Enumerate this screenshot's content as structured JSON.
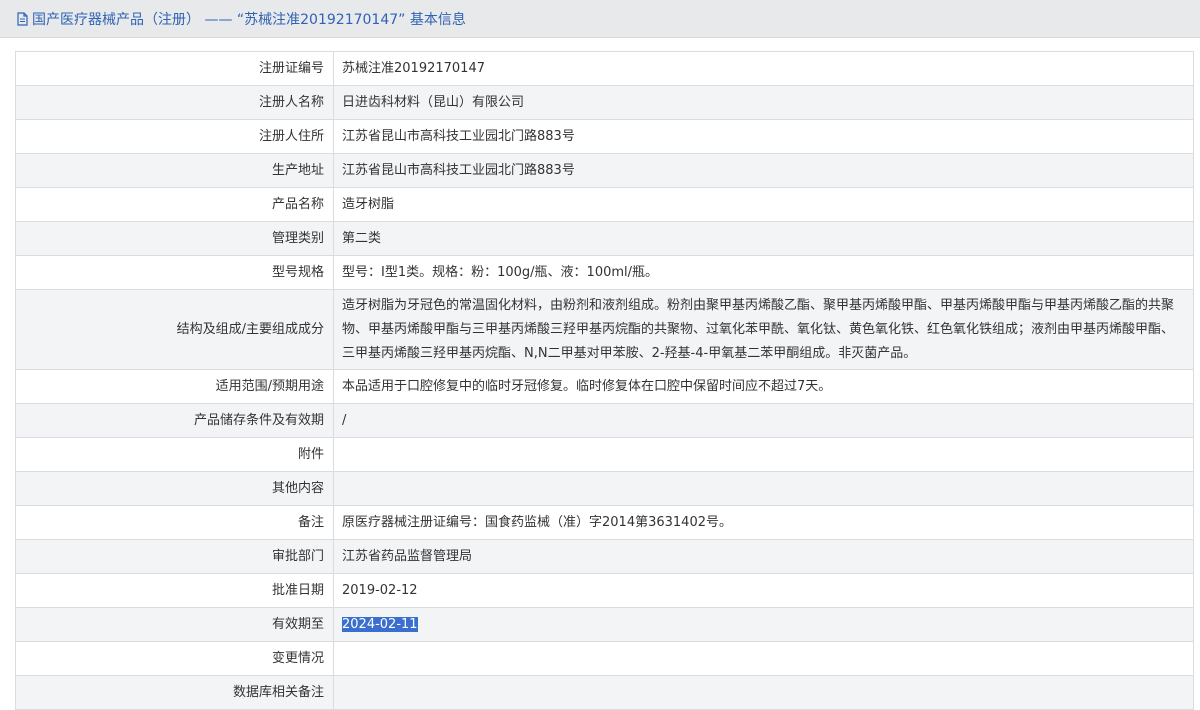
{
  "header": {
    "title": "国产医疗器械产品（注册） —— “苏械注准20192170147” 基本信息",
    "icon": "document-icon"
  },
  "rows": [
    {
      "label": "注册证编号",
      "value": "苏械注准20192170147"
    },
    {
      "label": "注册人名称",
      "value": "日进齿科材料（昆山）有限公司"
    },
    {
      "label": "注册人住所",
      "value": "江苏省昆山市高科技工业园北门路883号"
    },
    {
      "label": "生产地址",
      "value": "江苏省昆山市高科技工业园北门路883号"
    },
    {
      "label": "产品名称",
      "value": "造牙树脂"
    },
    {
      "label": "管理类别",
      "value": "第二类"
    },
    {
      "label": "型号规格",
      "value": "型号：Ⅰ型1类。规格：粉：100g/瓶、液：100ml/瓶。"
    },
    {
      "label": "结构及组成/主要组成成分",
      "value": "造牙树脂为牙冠色的常温固化材料，由粉剂和液剂组成。粉剂由聚甲基丙烯酸乙酯、聚甲基丙烯酸甲酯、甲基丙烯酸甲酯与甲基丙烯酸乙酯的共聚物、甲基丙烯酸甲酯与三甲基丙烯酸三羟甲基丙烷酯的共聚物、过氧化苯甲酰、氧化钛、黄色氧化铁、红色氧化铁组成；液剂由甲基丙烯酸甲酯、三甲基丙烯酸三羟甲基丙烷酯、N,N二甲基对甲苯胺、2-羟基-4-甲氧基二苯甲酮组成。非灭菌产品。"
    },
    {
      "label": "适用范围/预期用途",
      "value": "本品适用于口腔修复中的临时牙冠修复。临时修复体在口腔中保留时间应不超过7天。"
    },
    {
      "label": "产品储存条件及有效期",
      "value": "/"
    },
    {
      "label": "附件",
      "value": ""
    },
    {
      "label": "其他内容",
      "value": ""
    },
    {
      "label": "备注",
      "value": "原医疗器械注册证编号：国食药监械（准）字2014第3631402号。"
    },
    {
      "label": "审批部门",
      "value": "江苏省药品监督管理局"
    },
    {
      "label": "批准日期",
      "value": "2019-02-12"
    },
    {
      "label": "有效期至",
      "value": "2024-02-11"
    },
    {
      "label": "变更情况",
      "value": ""
    },
    {
      "label": "数据库相关备注",
      "value": ""
    }
  ],
  "colors": {
    "header_bg": "#e8e9eb",
    "title_color": "#2f63b5",
    "row_alt_bg": "#f3f4f6",
    "border": "#d9dde2",
    "selection_bg": "#3a6fd0"
  }
}
